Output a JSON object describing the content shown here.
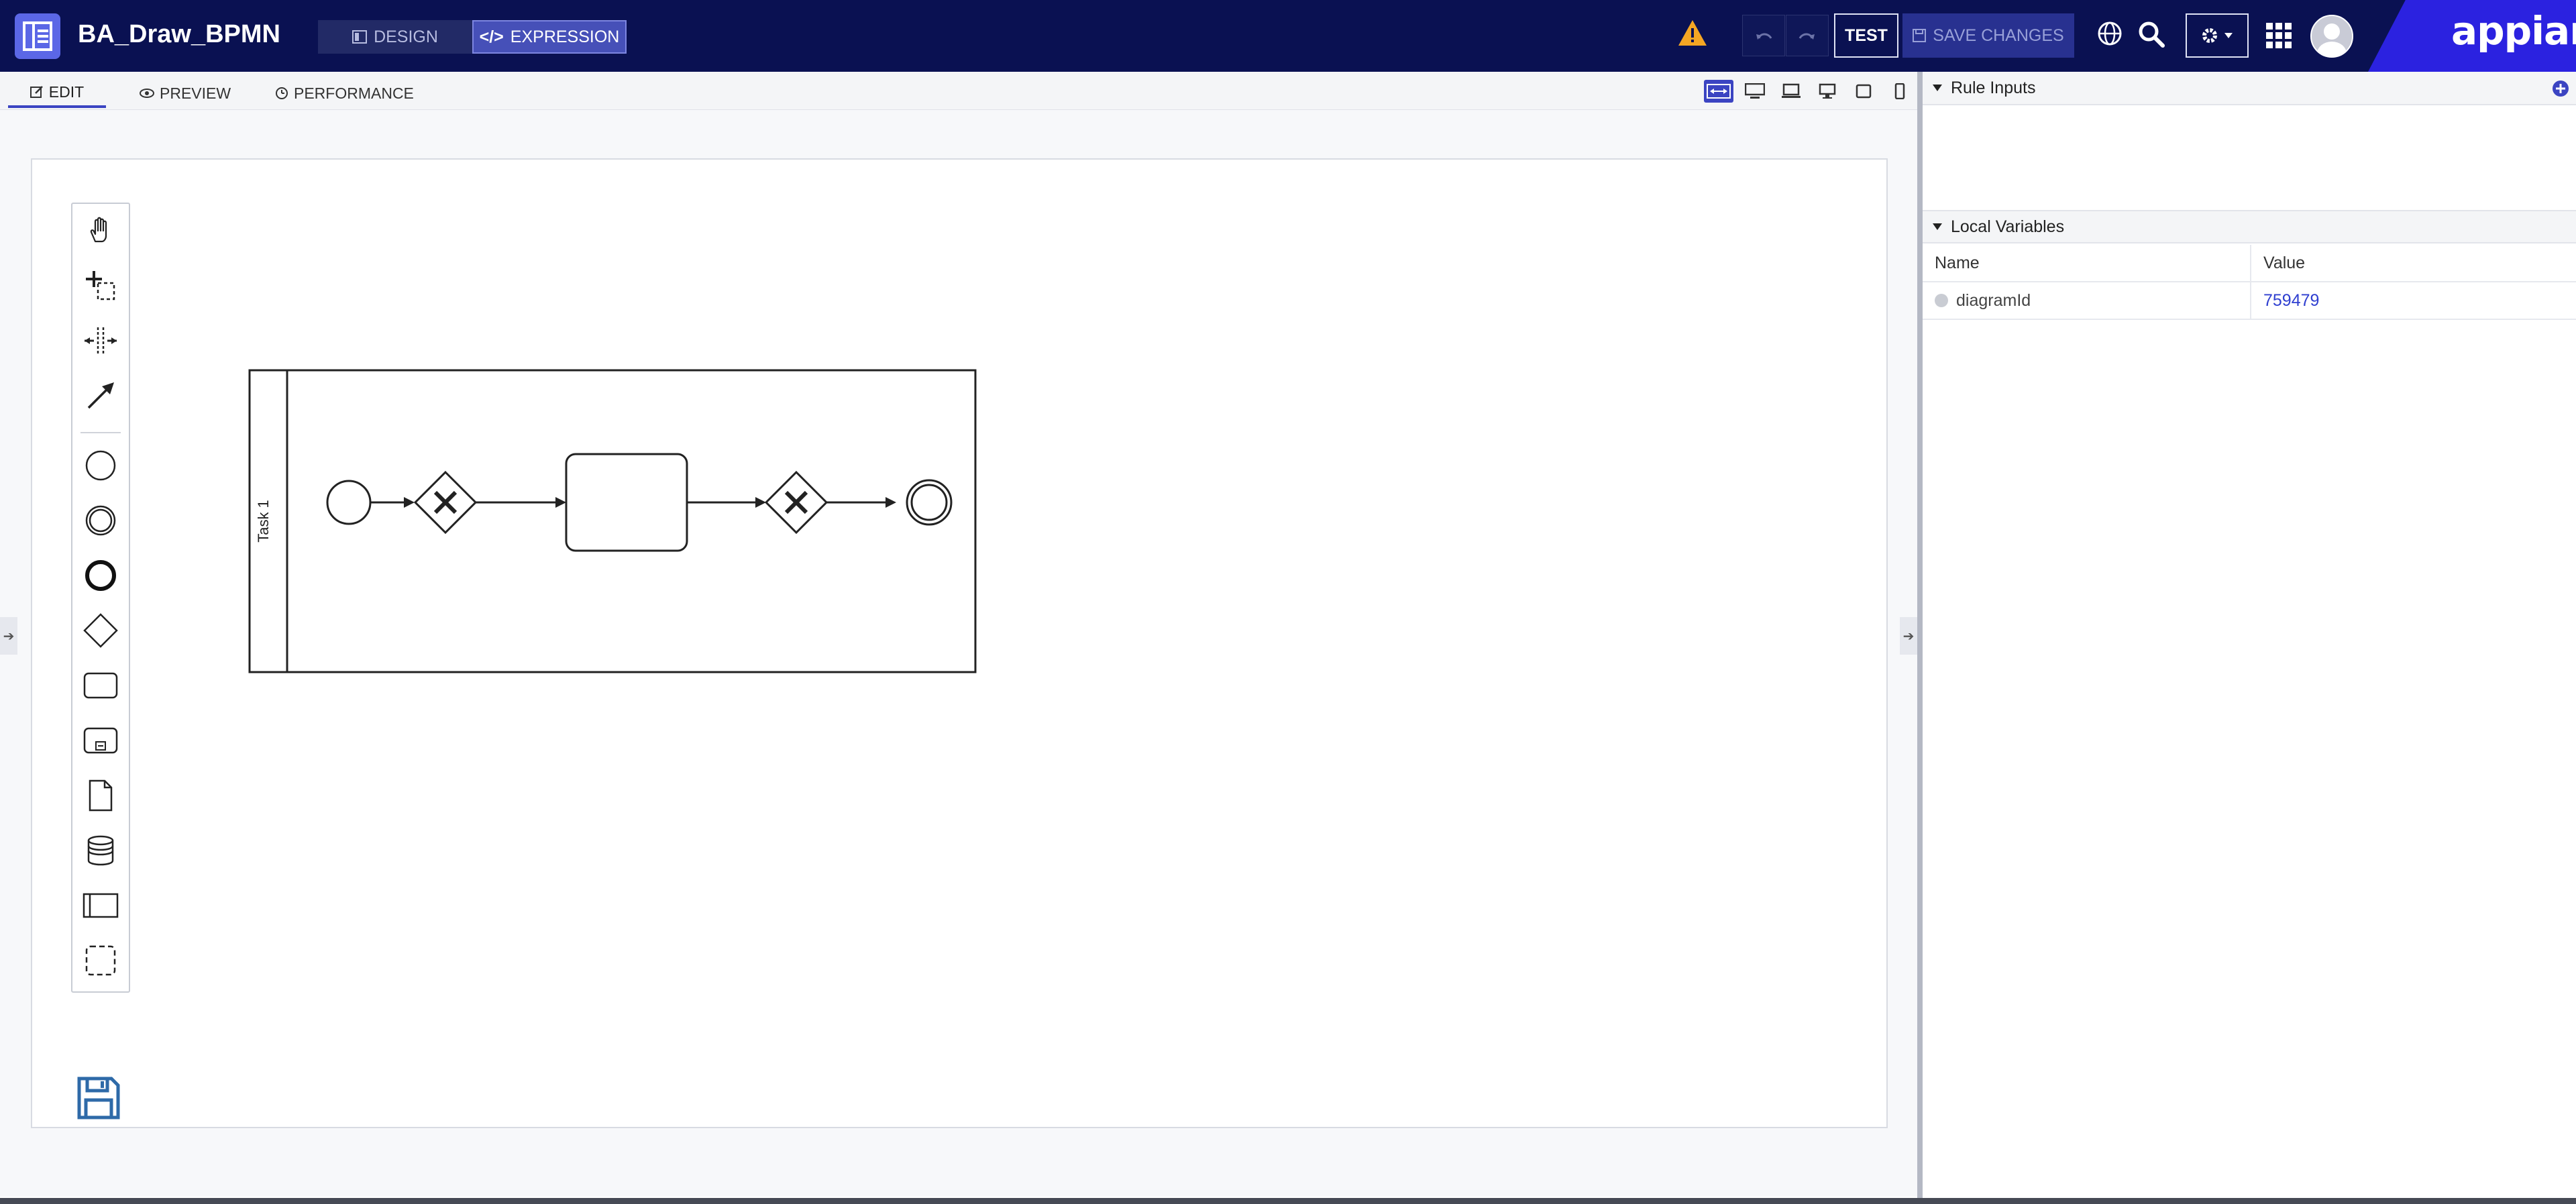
{
  "app": {
    "title": "BA_Draw_BPMN",
    "modes": {
      "design_label": "DESIGN",
      "expression_label": "EXPRESSION"
    },
    "toolbar": {
      "test_label": "TEST",
      "save_changes_label": "SAVE CHANGES"
    },
    "brand": "appian"
  },
  "editor": {
    "tabs": [
      {
        "label": "EDIT",
        "active": true
      },
      {
        "label": "PREVIEW",
        "active": false
      },
      {
        "label": "PERFORMANCE",
        "active": false
      }
    ],
    "device_views": [
      "fit-width",
      "desktop",
      "laptop",
      "tablet-landscape",
      "tablet-portrait",
      "phone"
    ]
  },
  "diagram": {
    "lane_label": "Task 1",
    "elements": [
      "start-event",
      "exclusive-gateway",
      "task",
      "exclusive-gateway",
      "end-event"
    ],
    "palette_tools": [
      "hand-tool",
      "lasso-tool",
      "space-tool",
      "global-connect-tool",
      "start-event",
      "intermediate-event",
      "end-event",
      "gateway",
      "task",
      "subprocess",
      "data-object",
      "data-store",
      "pool",
      "group"
    ]
  },
  "rule_inputs": {
    "title": "Rule Inputs"
  },
  "local_variables": {
    "title": "Local Variables",
    "columns": [
      "Name",
      "Value"
    ],
    "rows": [
      {
        "name": "diagramId",
        "value": "759479"
      }
    ]
  },
  "colors": {
    "topbar": "#0a1152",
    "accent": "#3b44c2",
    "brand": "#2b22e0",
    "warning": "#f5a623",
    "link": "#2f3fd0"
  }
}
